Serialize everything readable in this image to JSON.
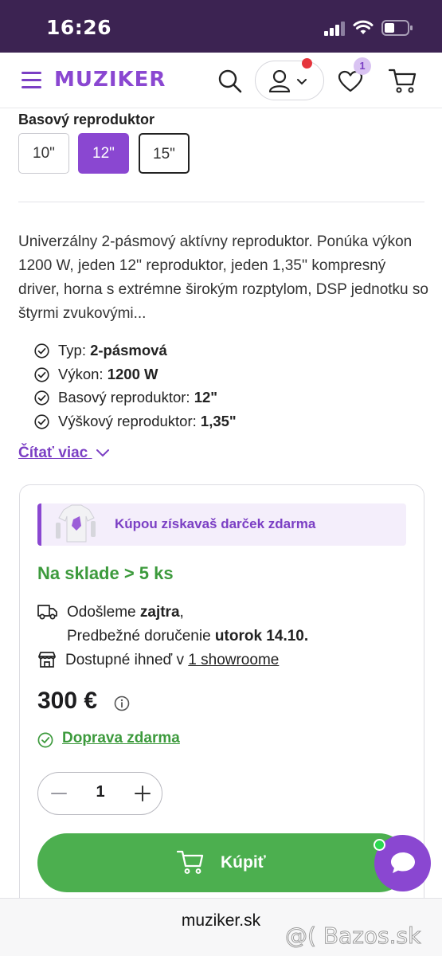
{
  "status": {
    "time": "16:26"
  },
  "header": {
    "logo": "MUZIKER",
    "wishlist_count": "1"
  },
  "variant": {
    "label": "Basový reproduktor",
    "options": [
      "10\"",
      "12\"",
      "15\""
    ],
    "selected": "12\""
  },
  "description": "Univerzálny 2-pásmový aktívny reproduktor. Ponúka výkon 1200 W, jeden 12'' reproduktor, jeden 1,35'' kompresný driver, horna s extrémne širokým rozptylom, DSP jednotku so štyrmi zvukovými...",
  "specs": [
    {
      "name": "Typ: ",
      "value": "2-pásmová"
    },
    {
      "name": "Výkon: ",
      "value": "1200 W"
    },
    {
      "name": "Basový reproduktor: ",
      "value": "12\""
    },
    {
      "name": "Výškový reproduktor: ",
      "value": "1,35\""
    }
  ],
  "read_more": "Čítať viac",
  "purchase": {
    "gift_text": "Kúpou získavaš darček zdarma",
    "stock": "Na sklade > 5 ks",
    "ship_prefix": "Odošleme ",
    "ship_day": "zajtra",
    "ship_suffix": ",",
    "delivery_prefix": "Predbežné doručenie ",
    "delivery_date": "utorok 14.10.",
    "showroom_prefix": "Dostupné ihneď v ",
    "showroom_link": "1 showroome",
    "price": "300 €",
    "free_shipping": "Doprava zdarma",
    "quantity": "1",
    "buy_label": "Kúpiť"
  },
  "browser": {
    "url": "muziker.sk",
    "watermark": "@( Bazos.sk"
  },
  "colors": {
    "brand": "#8a47d1",
    "green": "#4caf4f",
    "status_bar": "#3c2352"
  }
}
